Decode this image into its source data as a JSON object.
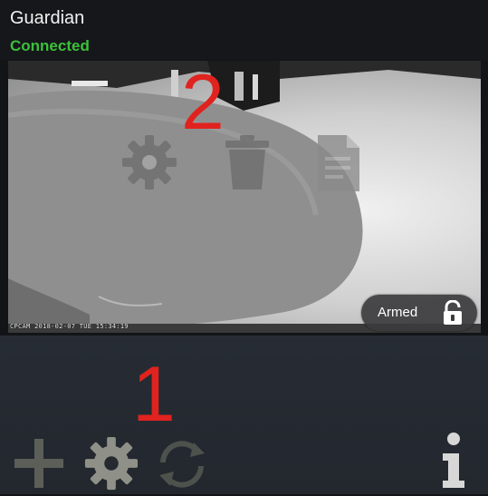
{
  "device": {
    "name": "Guardian",
    "status": "Connected"
  },
  "camera": {
    "timestamp": "CPCAM  2018-02-07  TUE  15:34:19",
    "armed_label": "Armed",
    "overlay_icons": [
      "gear-icon",
      "trash-icon",
      "document-icon"
    ]
  },
  "annotations": {
    "top": "2",
    "bottom": "1"
  },
  "toolbar": {
    "icons": [
      "plus-icon",
      "gear-icon",
      "refresh-icon",
      "info-icon"
    ]
  },
  "colors": {
    "status_green": "#3cc13b",
    "annotation_red": "#e0231f",
    "toolbar_bg": "#272c34"
  }
}
